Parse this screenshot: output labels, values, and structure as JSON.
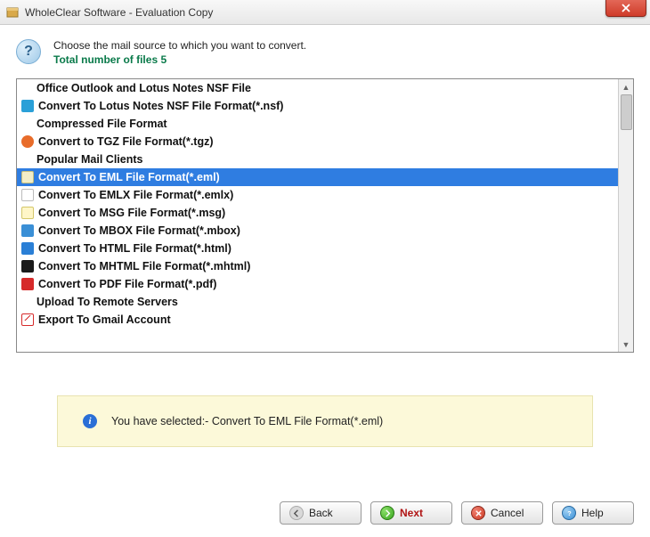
{
  "window": {
    "title": "WholeClear Software - Evaluation Copy"
  },
  "header": {
    "instruction": "Choose the mail source to which you want to convert.",
    "summary_prefix": "Total number of files ",
    "summary_count": "5"
  },
  "list": [
    {
      "kind": "header",
      "label": "Office Outlook and Lotus Notes NSF File"
    },
    {
      "kind": "item",
      "icon": "nsf",
      "label": "Convert To Lotus Notes NSF File Format(*.nsf)"
    },
    {
      "kind": "header",
      "label": "Compressed File Format"
    },
    {
      "kind": "item",
      "icon": "tgz",
      "label": "Convert to TGZ File Format(*.tgz)"
    },
    {
      "kind": "header",
      "label": "Popular Mail Clients"
    },
    {
      "kind": "item",
      "icon": "eml",
      "label": "Convert To EML File Format(*.eml)",
      "selected": true
    },
    {
      "kind": "item",
      "icon": "emlx",
      "label": "Convert To EMLX File Format(*.emlx)"
    },
    {
      "kind": "item",
      "icon": "msg",
      "label": "Convert To MSG File Format(*.msg)"
    },
    {
      "kind": "item",
      "icon": "mbox",
      "label": "Convert To MBOX File Format(*.mbox)"
    },
    {
      "kind": "item",
      "icon": "html",
      "label": "Convert To HTML File Format(*.html)"
    },
    {
      "kind": "item",
      "icon": "mhtml",
      "label": "Convert To MHTML File Format(*.mhtml)"
    },
    {
      "kind": "item",
      "icon": "pdf",
      "label": "Convert To PDF File Format(*.pdf)"
    },
    {
      "kind": "header",
      "label": "Upload To Remote Servers"
    },
    {
      "kind": "item",
      "icon": "gmail",
      "label": "Export To Gmail Account"
    }
  ],
  "info": {
    "prefix": "You have selected:- ",
    "selection": "Convert To EML File Format(*.eml)"
  },
  "buttons": {
    "back": "Back",
    "next": "Next",
    "cancel": "Cancel",
    "help": "Help"
  }
}
